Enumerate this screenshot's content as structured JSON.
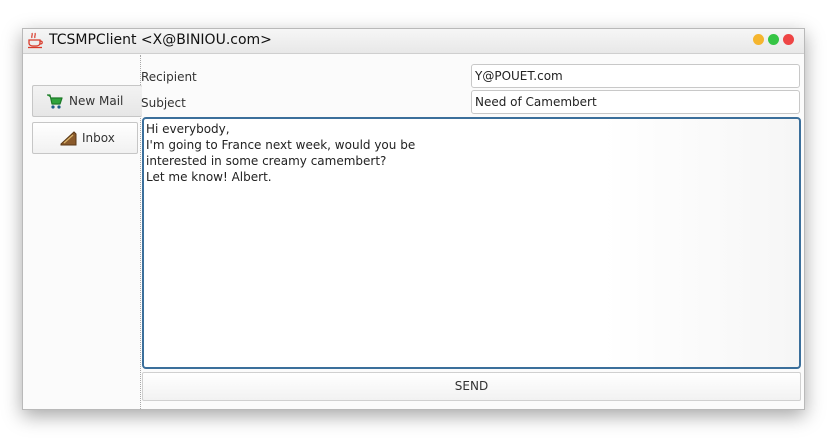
{
  "window": {
    "title": "TCSMPClient <X@BINIOU.com>",
    "controls": [
      "minimize",
      "maximize",
      "close"
    ]
  },
  "sidebar": {
    "items": [
      {
        "label": "New Mail",
        "icon": "shopping-cart-icon",
        "selected": true
      },
      {
        "label": "Inbox",
        "icon": "inbox-icon",
        "selected": false
      }
    ]
  },
  "compose": {
    "recipient_label": "Recipient",
    "recipient_value": "Y@POUET.com",
    "subject_label": "Subject",
    "subject_value": "Need of Camembert",
    "body": "Hi everybody,\nI'm going to France next week, would you be\ninterested in some creamy camembert?\nLet me know! Albert.",
    "send_label": "SEND"
  },
  "colors": {
    "focus_border": "#3b6f9b",
    "close": "#ee4545",
    "minimize": "#f5b52e",
    "maximize": "#36c545"
  }
}
